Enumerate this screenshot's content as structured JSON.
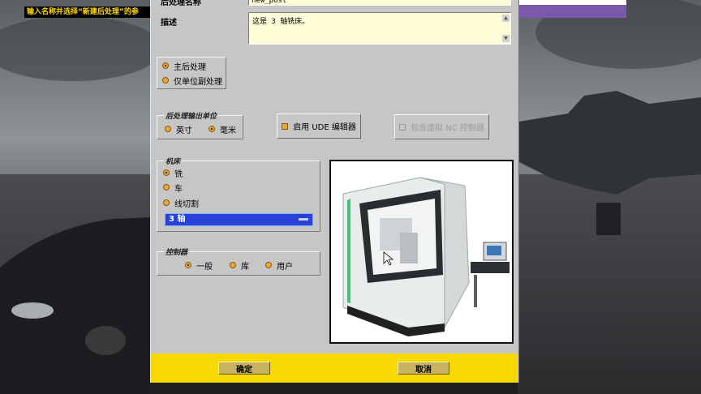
{
  "hint": {
    "text": "输入名称并选择“新建后处理”的参"
  },
  "dialog": {
    "postprocessor_name_label": "后处理名称",
    "postprocessor_name_value": "new_post",
    "description_label": "描述",
    "description_value": "这是 3 轴铣床。",
    "post_type": {
      "options": [
        {
          "label": "主后处理",
          "checked": true
        },
        {
          "label": "仅单位副处理",
          "checked": false
        }
      ]
    },
    "output_unit": {
      "title": "后处理输出单位",
      "options": [
        {
          "label": "英寸",
          "checked": false
        },
        {
          "label": "毫米",
          "checked": true
        }
      ]
    },
    "ude_editor": {
      "label": "启用 UDE 编辑器",
      "checked": true
    },
    "virtual_nc": {
      "label": "包含虚拟 NC 控制器",
      "checked": false,
      "disabled": true
    },
    "machine": {
      "title": "机床",
      "options": [
        {
          "label": "铣",
          "checked": true
        },
        {
          "label": "车",
          "checked": false
        },
        {
          "label": "线切割",
          "checked": false
        }
      ],
      "axis_selected": "3 轴"
    },
    "controller": {
      "title": "控制器",
      "options": [
        {
          "label": "一般",
          "checked": true
        },
        {
          "label": "库",
          "checked": false
        },
        {
          "label": "用户",
          "checked": false
        }
      ]
    },
    "ok_label": "确定",
    "cancel_label": "取消"
  },
  "icons": {
    "scroll_up": "up-arrow-icon",
    "scroll_down": "down-arrow-icon",
    "dropdown": "dropdown-bar-icon"
  },
  "colors": {
    "footer": "#f7d800",
    "selection": "#2742d8",
    "radio": "#e8a830",
    "input_bg": "#fffdd8"
  }
}
